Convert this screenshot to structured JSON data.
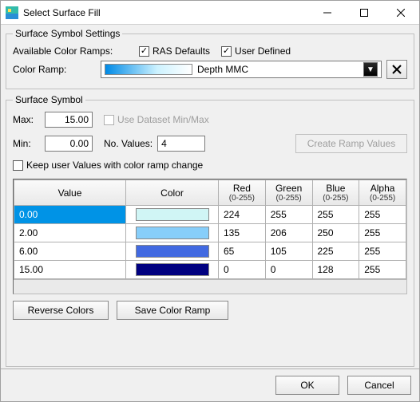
{
  "window": {
    "title": "Select Surface Fill"
  },
  "settings_group": {
    "legend": "Surface Symbol Settings",
    "available_label": "Available Color Ramps:",
    "ras_defaults_label": "RAS Defaults",
    "ras_defaults_checked": true,
    "user_defined_label": "User Defined",
    "user_defined_checked": true,
    "color_ramp_label": "Color Ramp:",
    "ramp_name": "Depth MMC"
  },
  "symbol_group": {
    "legend": "Surface Symbol",
    "max_label": "Max:",
    "max_value": "15.00",
    "min_label": "Min:",
    "min_value": "0.00",
    "use_dataset_label": "Use Dataset Min/Max",
    "no_values_label": "No. Values:",
    "no_values": "4",
    "create_ramp_label": "Create Ramp Values",
    "keep_values_label": "Keep user Values with color ramp change",
    "keep_values_checked": false,
    "headers": {
      "value": "Value",
      "color": "Color",
      "red": "Red",
      "green": "Green",
      "blue": "Blue",
      "alpha": "Alpha",
      "range": "(0-255)"
    },
    "rows": [
      {
        "value": "0.00",
        "color": "#d0f5f5",
        "r": "224",
        "g": "255",
        "b": "255",
        "a": "255",
        "selected": true
      },
      {
        "value": "2.00",
        "color": "#87cefa",
        "r": "135",
        "g": "206",
        "b": "250",
        "a": "255",
        "selected": false
      },
      {
        "value": "6.00",
        "color": "#4169e1",
        "r": "65",
        "g": "105",
        "b": "225",
        "a": "255",
        "selected": false
      },
      {
        "value": "15.00",
        "color": "#000080",
        "r": "0",
        "g": "0",
        "b": "128",
        "a": "255",
        "selected": false
      }
    ],
    "reverse_label": "Reverse Colors",
    "save_ramp_label": "Save Color Ramp"
  },
  "footer": {
    "ok": "OK",
    "cancel": "Cancel"
  }
}
